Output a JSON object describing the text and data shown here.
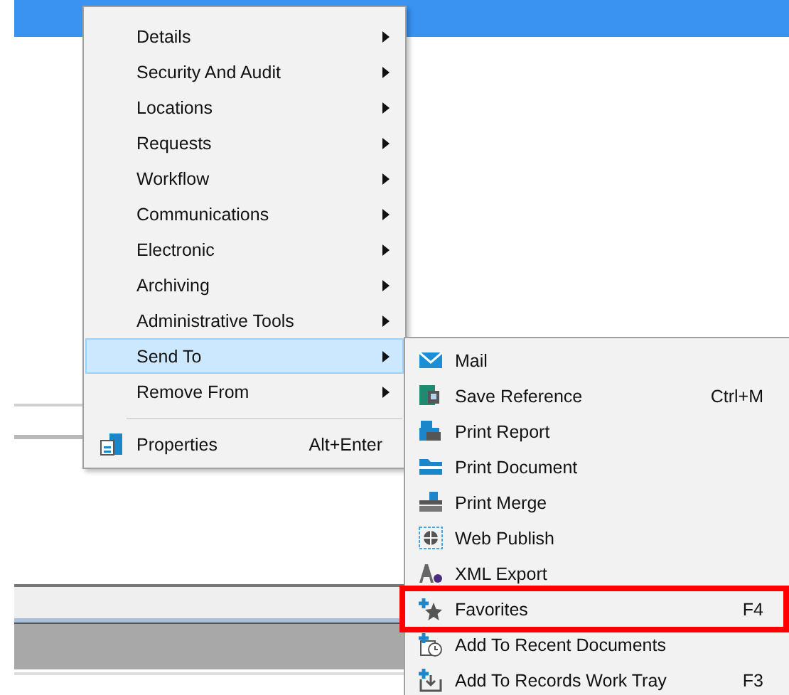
{
  "context_menu": {
    "items": [
      {
        "label": "Details",
        "kind": "submenu",
        "selected": false
      },
      {
        "label": "Security And Audit",
        "kind": "submenu",
        "selected": false
      },
      {
        "label": "Locations",
        "kind": "submenu",
        "selected": false
      },
      {
        "label": "Requests",
        "kind": "submenu",
        "selected": false
      },
      {
        "label": "Workflow",
        "kind": "submenu",
        "selected": false
      },
      {
        "label": "Communications",
        "kind": "submenu",
        "selected": false
      },
      {
        "label": "Electronic",
        "kind": "submenu",
        "selected": false
      },
      {
        "label": "Archiving",
        "kind": "submenu",
        "selected": false
      },
      {
        "label": "Administrative Tools",
        "kind": "submenu",
        "selected": false
      },
      {
        "label": "Send To",
        "kind": "submenu",
        "selected": true
      },
      {
        "label": "Remove From",
        "kind": "submenu",
        "selected": false
      },
      {
        "label": "Properties",
        "kind": "command",
        "shortcut": "Alt+Enter",
        "selected": false
      }
    ]
  },
  "send_to_submenu": {
    "items": [
      {
        "label": "Mail",
        "highlighted": false
      },
      {
        "label": "Save Reference",
        "shortcut": "Ctrl+M",
        "highlighted": false
      },
      {
        "label": "Print Report",
        "highlighted": false
      },
      {
        "label": "Print Document",
        "highlighted": false
      },
      {
        "label": "Print Merge",
        "highlighted": false
      },
      {
        "label": "Web Publish",
        "highlighted": false
      },
      {
        "label": "XML Export",
        "highlighted": false
      },
      {
        "label": "Favorites",
        "shortcut": "F4",
        "highlighted": true
      },
      {
        "label": "Add To Recent Documents",
        "highlighted": false
      },
      {
        "label": "Add To Records Work Tray",
        "shortcut": "F3",
        "highlighted": false
      }
    ]
  }
}
